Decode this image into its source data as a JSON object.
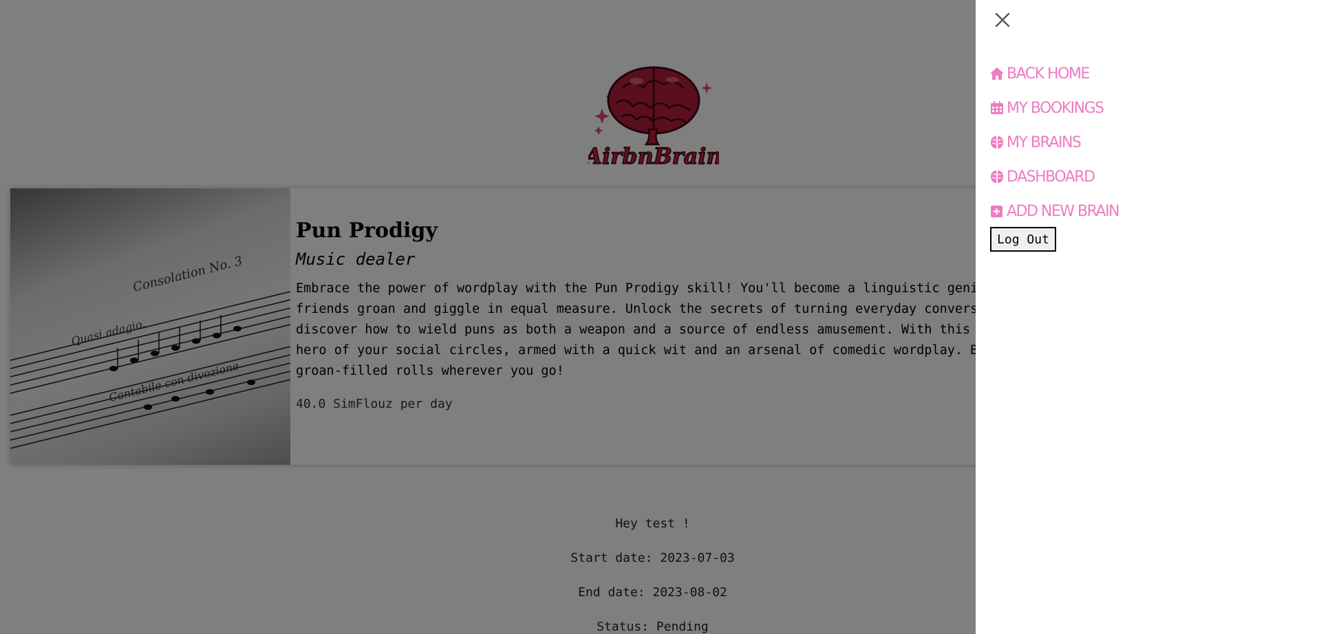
{
  "brand": {
    "logo_text": "AirbnBrain"
  },
  "listing": {
    "title": "Pun Prodigy",
    "subtitle": "Music dealer",
    "description": "Embrace the power of wordplay with the Pun Prodigy skill! You'll become a linguistic genius, effortlessly crafting puns that leave friends groan and giggle in equal measure. Unlock the secrets of turning everyday conversations into pun-filled exchanges and discover how to wield puns as both a weapon and a source of endless amusement. With this skill, you'll become the undisputed pun hero of your social circles, armed with a quick wit and an arsenal of comedic wordplay. Be prepared for eye-rolls, laughter and groan-filled rolls wherever you go!",
    "price": "40.0 SimFlouz per day"
  },
  "booking": {
    "greeting": "Hey test !",
    "start_date": "Start date: 2023-07-03",
    "end_date": "End date: 2023-08-02",
    "status": "Status: Pending"
  },
  "sidebar": {
    "items": [
      {
        "label": "BACK HOME",
        "icon": "home-icon"
      },
      {
        "label": "MY BOOKINGS",
        "icon": "calendar-icon"
      },
      {
        "label": "MY BRAINS",
        "icon": "brain-icon"
      },
      {
        "label": "DASHBOARD",
        "icon": "brain-icon"
      },
      {
        "label": "ADD NEW BRAIN",
        "icon": "plus-square-icon"
      }
    ],
    "logout_label": "Log Out",
    "close_icon": "close-icon"
  },
  "colors": {
    "nav_pink": "#f07ac2",
    "logo_red": "#c8203e",
    "overlay": "rgba(0,0,0,0.5)"
  }
}
